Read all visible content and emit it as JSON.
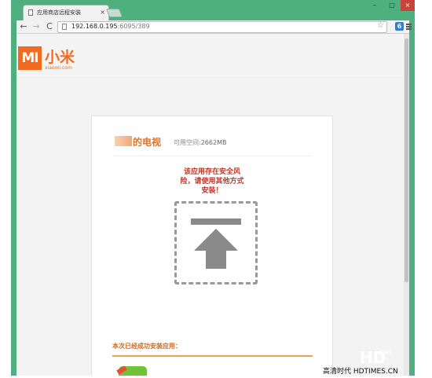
{
  "browser": {
    "tab_title": "应用商店远程安装",
    "tab_close": "×",
    "window_controls": {
      "minimize": "–",
      "maximize": "□",
      "close": "×"
    },
    "nav": {
      "back": "←",
      "forward": "→",
      "reload": "C"
    },
    "url_host": "192.168.0.195",
    "url_path": ":6095/389",
    "star": "☆",
    "extension_label": "6"
  },
  "site": {
    "logo_mark": "MI",
    "brand_cn": "小米",
    "brand_url": "xiaomi.com"
  },
  "card": {
    "device_name": "的电视",
    "space_label": "可用空间:",
    "space_value": "2662MB",
    "warning_lines": [
      "该应用存在安全风",
      "险，请使用其他方式",
      "安装！"
    ],
    "success_text": "本次已经成功安装应用："
  },
  "watermark": {
    "logo": "HD",
    "logo_sub": "高清时代",
    "text": "高清时代 HDTIMES.CN"
  },
  "colors": {
    "frame_green": "#4db07e",
    "brand_orange": "#f26a21",
    "warning_red": "#c0392b"
  }
}
